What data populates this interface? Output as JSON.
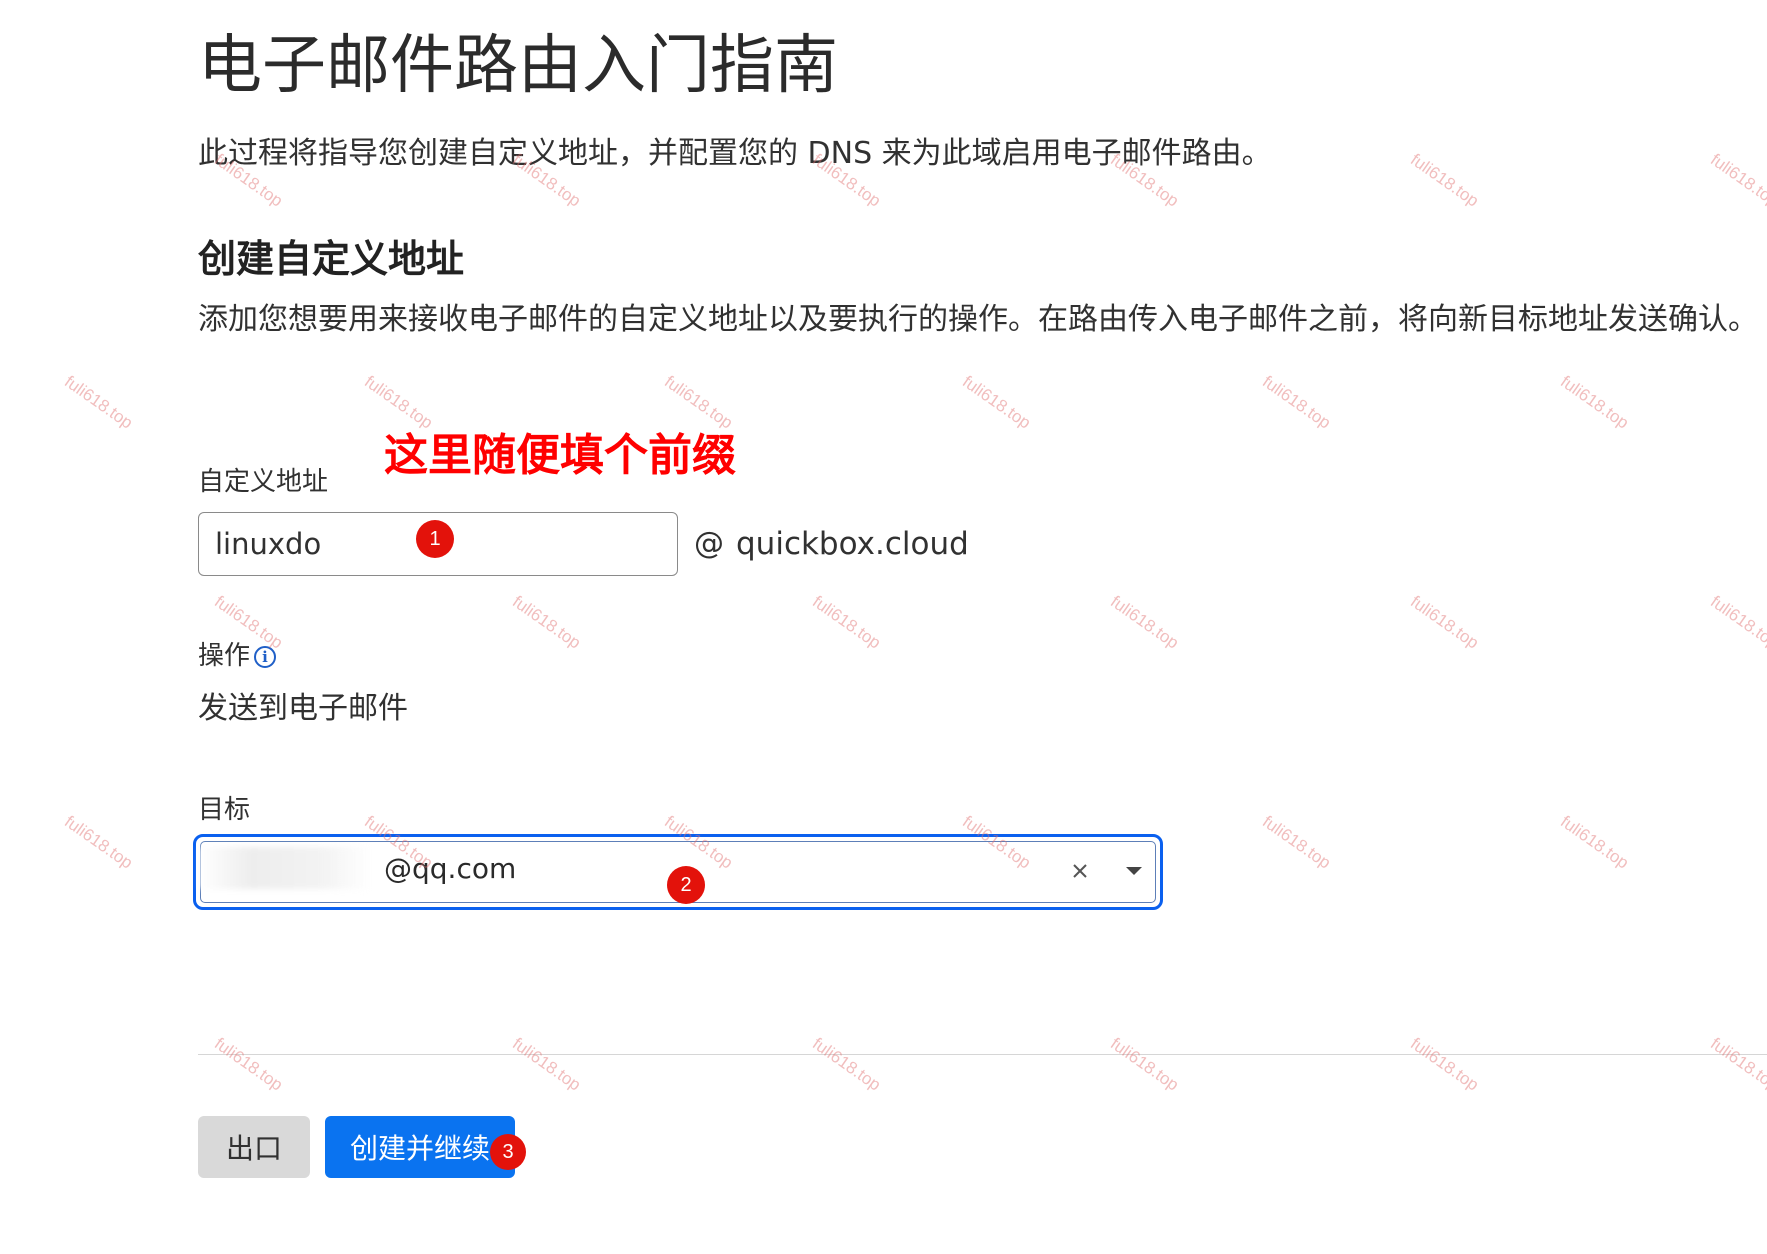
{
  "page": {
    "title": "电子邮件路由入门指南",
    "intro": "此过程将指导您创建自定义地址，并配置您的 DNS 来为此域启用电子邮件路由。"
  },
  "section": {
    "title": "创建自定义地址",
    "description": "添加您想要用来接收电子邮件的自定义地址以及要执行的操作。在路由传入电子邮件之前，将向新目标地址发送确认。"
  },
  "annotation": {
    "text": "这里随便填个前缀",
    "color": "#ff0000",
    "badges": [
      "1",
      "2",
      "3"
    ]
  },
  "form": {
    "custom_address": {
      "label": "自定义地址",
      "value": "linuxdo",
      "at": "@",
      "domain": "quickbox.cloud"
    },
    "action": {
      "label": "操作",
      "info_icon": "ⓘ",
      "value": "发送到电子邮件"
    },
    "target": {
      "label": "目标",
      "value": "@qq.com"
    }
  },
  "buttons": {
    "exit": "出口",
    "create": "创建并继续"
  },
  "watermark": "fuli618.top",
  "colors": {
    "primary": "#0a73f0",
    "focus_border": "#0a60ef",
    "badge": "#e3120b",
    "info_icon": "#1f5fc7"
  }
}
